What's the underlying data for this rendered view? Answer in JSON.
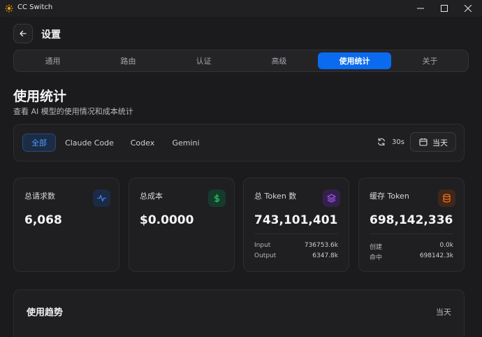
{
  "window": {
    "title": "CC Switch"
  },
  "header": {
    "title": "设置"
  },
  "tabs": [
    {
      "label": "通用",
      "active": false
    },
    {
      "label": "路由",
      "active": false
    },
    {
      "label": "认证",
      "active": false
    },
    {
      "label": "高级",
      "active": false
    },
    {
      "label": "使用统计",
      "active": true
    },
    {
      "label": "关于",
      "active": false
    }
  ],
  "page": {
    "title": "使用统计",
    "subtitle": "查看 AI 模型的使用情况和成本统计"
  },
  "filters": {
    "apps": [
      {
        "label": "全部",
        "active": true
      },
      {
        "label": "Claude Code",
        "active": false
      },
      {
        "label": "Codex",
        "active": false
      },
      {
        "label": "Gemini",
        "active": false
      }
    ],
    "refresh_interval": "30s",
    "date_range": "当天"
  },
  "cards": {
    "requests": {
      "label": "总请求数",
      "value": "6,068",
      "icon": "activity-icon",
      "color": "#3b82f6"
    },
    "cost": {
      "label": "总成本",
      "value": "$0.0000",
      "icon": "dollar-icon",
      "color": "#22c55e"
    },
    "tokens": {
      "label": "总 Token 数",
      "value": "743,101,401",
      "icon": "layers-icon",
      "color": "#a855f7",
      "rows": [
        {
          "name": "Input",
          "value": "736753.6k"
        },
        {
          "name": "Output",
          "value": "6347.8k"
        }
      ]
    },
    "cache": {
      "label": "缓存 Token",
      "value": "698,142,336",
      "icon": "database-icon",
      "color": "#f97316",
      "rows": [
        {
          "name": "创建",
          "value": "0.0k"
        },
        {
          "name": "命中",
          "value": "698142.3k"
        }
      ]
    }
  },
  "trend": {
    "title": "使用趋势",
    "range": "当天"
  }
}
